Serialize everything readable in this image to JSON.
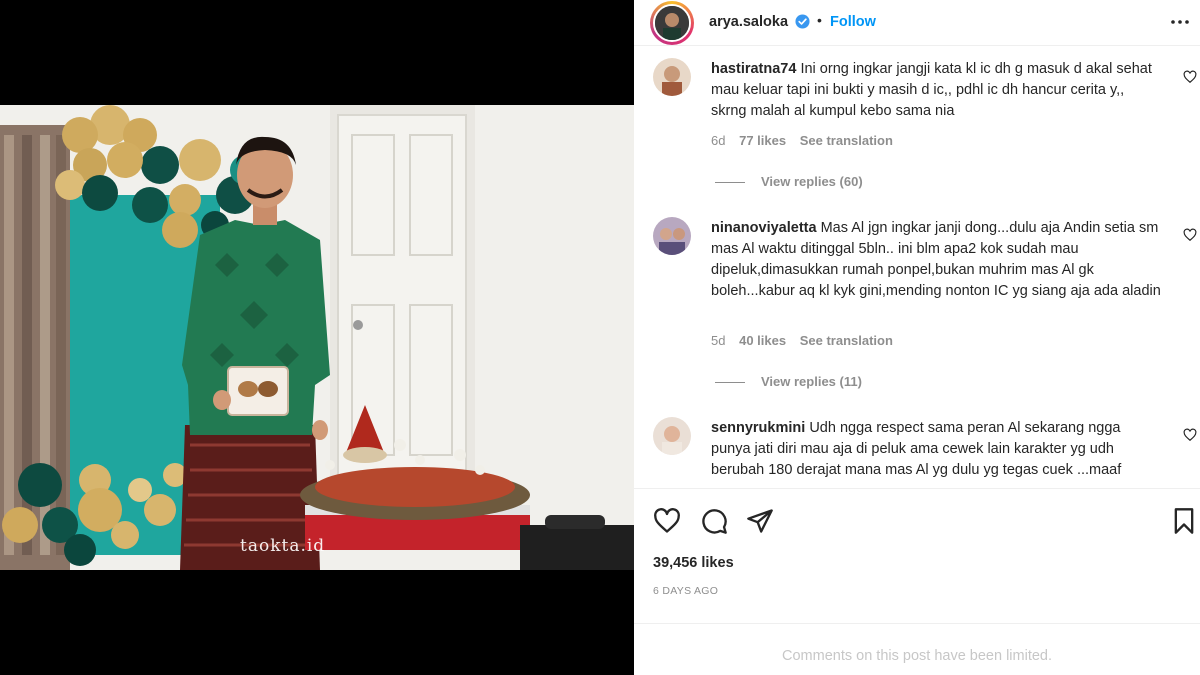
{
  "post": {
    "watermark": "taokta.id",
    "author": {
      "username": "arya.saloka",
      "verified": true,
      "follow_label": "Follow",
      "separator": "•"
    },
    "likes": "39,456 likes",
    "date": "6 DAYS AGO",
    "comments_limited": "Comments on this post have been limited."
  },
  "comments": [
    {
      "username": "hastiratna74",
      "text": "Ini orng ingkar jangji kata kl ic dh g masuk d akal sehat mau keluar tapi ini bukti y masih d ic,, pdhl ic dh hancur cerita y,, skrng malah al kumpul kebo sama nia",
      "age": "6d",
      "likes": "77 likes",
      "translate": "See translation",
      "replies": "View replies (60)"
    },
    {
      "username": "ninanoviyaletta",
      "text": "Mas Al jgn ingkar janji dong...dulu aja Andin setia sm mas Al waktu ditinggal 5bln.. ini blm apa2 kok sudah mau dipeluk,dimasukkan rumah ponpel,bukan muhrim mas Al gk boleh...kabur aq kl kyk gini,mending nonton IC yg siang aja ada aladin",
      "age": "5d",
      "likes": "40 likes",
      "translate": "See translation",
      "replies": "View replies (11)"
    },
    {
      "username": "sennyrukmini",
      "text": "Udh ngga respect sama peran Al sekarang ngga punya jati diri mau aja di peluk ama cewek lain karakter yg udh berubah 180 derajat mana mas Al yg dulu yg tegas cuek ...maaf"
    }
  ],
  "icons": {
    "like": "heart-icon",
    "comment": "comment-icon",
    "share": "share-icon",
    "save": "bookmark-icon",
    "more": "more-icon",
    "verified": "verified-badge-icon"
  },
  "colors": {
    "link": "#0095f6",
    "muted": "#8e8e8e",
    "text": "#262626"
  }
}
